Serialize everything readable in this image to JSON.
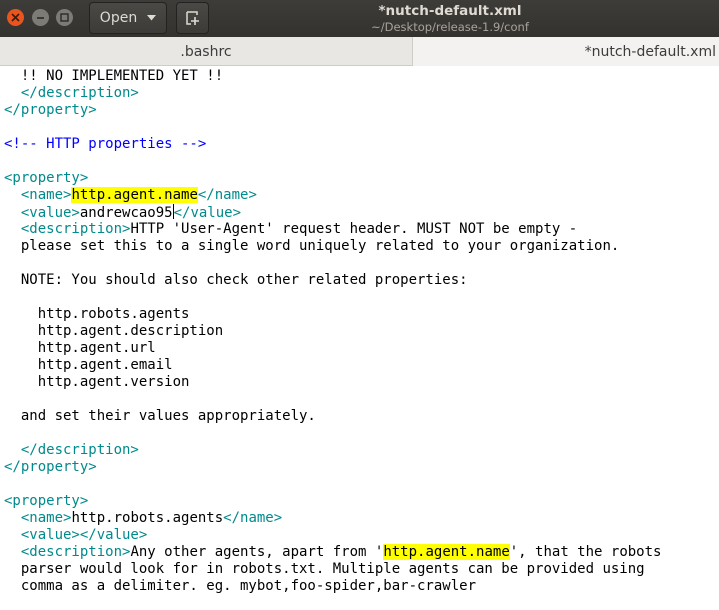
{
  "window": {
    "title": "*nutch-default.xml",
    "path": "~/Desktop/release-1.9/conf",
    "open_label": "Open",
    "controls": {
      "close_icon": "close-icon",
      "minimize_icon": "minimize-icon",
      "maximize_icon": "maximize-icon"
    }
  },
  "tabs": [
    {
      "label": ".bashrc",
      "active": false
    },
    {
      "label": "*nutch-default.xml",
      "active": true
    }
  ],
  "colors": {
    "tag": "#008a8c",
    "comment": "#0000ff",
    "highlight": "#ffff00",
    "headerbar": "#3a3935"
  },
  "editor": {
    "lines": [
      {
        "segments": [
          {
            "t": "  !! NO IMPLEMENTED YET !!"
          }
        ]
      },
      {
        "segments": [
          {
            "t": "  "
          },
          {
            "t": "</description>",
            "c": "tag"
          }
        ]
      },
      {
        "segments": [
          {
            "t": "</property>",
            "c": "tag"
          }
        ]
      },
      {
        "segments": []
      },
      {
        "segments": [
          {
            "t": "<!-- HTTP properties -->",
            "c": "comment"
          }
        ]
      },
      {
        "segments": []
      },
      {
        "segments": [
          {
            "t": "<property>",
            "c": "tag"
          }
        ]
      },
      {
        "segments": [
          {
            "t": "  "
          },
          {
            "t": "<name>",
            "c": "tag"
          },
          {
            "t": "http.agent.name",
            "hl": true
          },
          {
            "t": "</name>",
            "c": "tag"
          }
        ]
      },
      {
        "segments": [
          {
            "t": "  "
          },
          {
            "t": "<value>",
            "c": "tag"
          },
          {
            "t": "andrewcao95",
            "caret": true
          },
          {
            "t": "</value>",
            "c": "tag"
          }
        ]
      },
      {
        "segments": [
          {
            "t": "  "
          },
          {
            "t": "<description>",
            "c": "tag"
          },
          {
            "t": "HTTP 'User-Agent' request header. MUST NOT be empty -"
          }
        ]
      },
      {
        "segments": [
          {
            "t": "  please set this to a single word uniquely related to your organization."
          }
        ]
      },
      {
        "segments": []
      },
      {
        "segments": [
          {
            "t": "  NOTE: You should also check other related properties:"
          }
        ]
      },
      {
        "segments": []
      },
      {
        "segments": [
          {
            "t": "    http.robots.agents"
          }
        ]
      },
      {
        "segments": [
          {
            "t": "    http.agent.description"
          }
        ]
      },
      {
        "segments": [
          {
            "t": "    http.agent.url"
          }
        ]
      },
      {
        "segments": [
          {
            "t": "    http.agent.email"
          }
        ]
      },
      {
        "segments": [
          {
            "t": "    http.agent.version"
          }
        ]
      },
      {
        "segments": []
      },
      {
        "segments": [
          {
            "t": "  and set their values appropriately."
          }
        ]
      },
      {
        "segments": []
      },
      {
        "segments": [
          {
            "t": "  "
          },
          {
            "t": "</description>",
            "c": "tag"
          }
        ]
      },
      {
        "segments": [
          {
            "t": "</property>",
            "c": "tag"
          }
        ]
      },
      {
        "segments": []
      },
      {
        "segments": [
          {
            "t": "<property>",
            "c": "tag"
          }
        ]
      },
      {
        "segments": [
          {
            "t": "  "
          },
          {
            "t": "<name>",
            "c": "tag"
          },
          {
            "t": "http.robots.agents"
          },
          {
            "t": "</name>",
            "c": "tag"
          }
        ]
      },
      {
        "segments": [
          {
            "t": "  "
          },
          {
            "t": "<value></value>",
            "c": "tag"
          }
        ]
      },
      {
        "segments": [
          {
            "t": "  "
          },
          {
            "t": "<description>",
            "c": "tag"
          },
          {
            "t": "Any other agents, apart from '"
          },
          {
            "t": "http.agent.name",
            "hl": true
          },
          {
            "t": "', that the robots"
          }
        ]
      },
      {
        "segments": [
          {
            "t": "  parser would look for in robots.txt. Multiple agents can be provided using"
          }
        ]
      },
      {
        "segments": [
          {
            "t": "  comma as a delimiter. eg. mybot,foo-spider,bar-crawler"
          }
        ]
      }
    ]
  }
}
